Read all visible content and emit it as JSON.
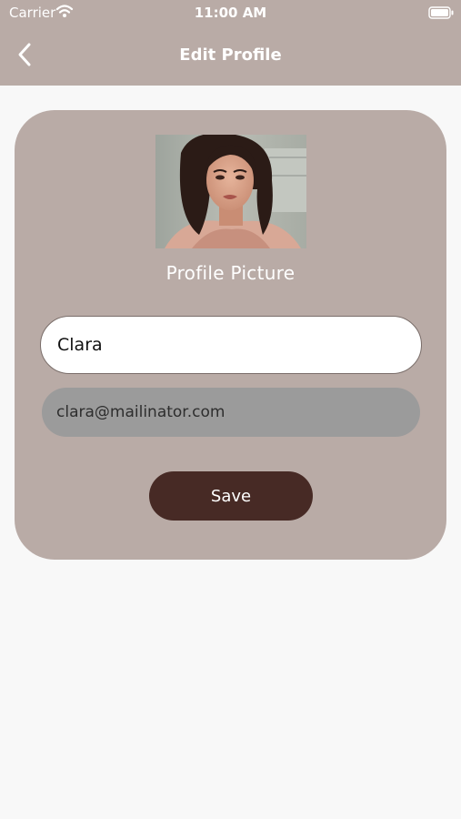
{
  "status_bar": {
    "carrier": "Carrier",
    "time": "11:00 AM"
  },
  "nav": {
    "title": "Edit Profile",
    "back_icon": "chevron-left-icon"
  },
  "profile": {
    "picture_label": "Profile Picture"
  },
  "form": {
    "name_value": "Clara",
    "email_value": "clara@mailinator.com",
    "save_label": "Save"
  },
  "colors": {
    "header_bg": "#b9aba6",
    "card_bg": "#b9aba6",
    "page_bg": "#f8f8f8",
    "button_bg": "#472a25",
    "email_bg": "#9b9b9b"
  }
}
